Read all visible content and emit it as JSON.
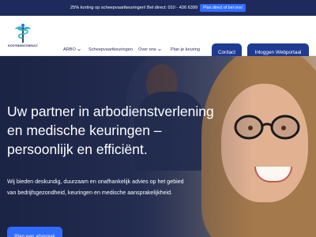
{
  "promo": {
    "text": "25% korting op scheepvaartkeuringen! Bel direct: 010 - 426 6399",
    "cta": "Plan direct of bel ons!"
  },
  "brand": {
    "name": "KOOYMANCONSULT"
  },
  "nav": {
    "items": [
      {
        "label": "ARBO",
        "has_dropdown": true
      },
      {
        "label": "Scheepvaartkeuringen",
        "has_dropdown": false
      },
      {
        "label": "Over ons",
        "has_dropdown": true
      },
      {
        "label": "Plan je keuring",
        "has_dropdown": false
      }
    ],
    "contact_label": "Contact",
    "login_label": "Inloggen Webportaal"
  },
  "hero": {
    "title_lines": [
      "Uw partner in arbodienstverlening",
      "en medische keuringen –",
      "persoonlijk en efficiënt."
    ],
    "description_lines": [
      "Wij bieden deskundig, duurzaam en onafhankelijk advies op het gebied",
      "van bedrijfsgezondheid, keuringen en medische aansprakelijkheid."
    ],
    "cta_label": "Plan een afspraak"
  },
  "colors": {
    "navy": "#1f2a5c",
    "button": "#1f3a93",
    "accent": "#2f6cff"
  }
}
